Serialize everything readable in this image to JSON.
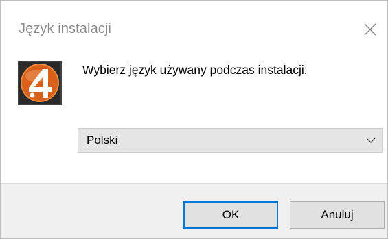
{
  "window": {
    "title": "Język instalacji"
  },
  "dialog": {
    "prompt": "Wybierz język używany podczas instalacji:",
    "language_select": {
      "selected": "Polski"
    }
  },
  "buttons": {
    "ok_label": "OK",
    "cancel_label": "Anuluj"
  },
  "colors": {
    "accent": "#0078d7",
    "logo_orange": "#e06a1f"
  }
}
